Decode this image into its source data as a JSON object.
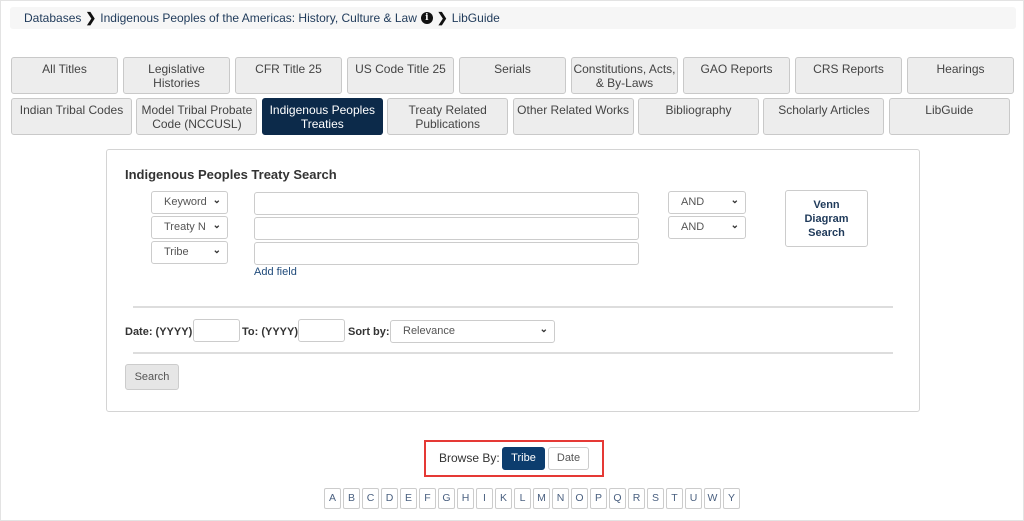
{
  "breadcrumb": {
    "items": [
      "Databases",
      "Indigenous Peoples of the Americas: History, Culture & Law",
      "LibGuide"
    ]
  },
  "tabs_row1": [
    "All Titles",
    "Legislative Histories",
    "CFR Title 25",
    "US Code Title 25",
    "Serials",
    "Constitutions, Acts, & By-Laws",
    "GAO Reports",
    "CRS Reports",
    "Hearings"
  ],
  "tabs_row2": [
    "Indian Tribal Codes",
    "Model Tribal Probate Code (NCCUSL)",
    "Indigenous Peoples Treaties",
    "Treaty Related Publications",
    "Other Related Works",
    "Bibliography",
    "Scholarly Articles",
    "LibGuide"
  ],
  "active_tab": "Indigenous Peoples Treaties",
  "search": {
    "title": "Indigenous Peoples Treaty Search",
    "fields": [
      "Keyword",
      "Treaty N",
      "Tribe"
    ],
    "operators": [
      "AND",
      "AND"
    ],
    "add_field": "Add field",
    "venn": "Venn Diagram Search",
    "date_from_label": "Date: (YYYY)",
    "date_to_label": "To: (YYYY)",
    "sort_label": "Sort by:",
    "sort_value": "Relevance",
    "search_button": "Search"
  },
  "browse": {
    "label": "Browse By:",
    "options": [
      "Tribe",
      "Date"
    ],
    "selected": "Tribe",
    "highlight_color": "#e53935"
  },
  "letters": [
    "A",
    "B",
    "C",
    "D",
    "E",
    "F",
    "G",
    "H",
    "I",
    "K",
    "L",
    "M",
    "N",
    "O",
    "P",
    "Q",
    "R",
    "S",
    "T",
    "U",
    "W",
    "Y"
  ]
}
